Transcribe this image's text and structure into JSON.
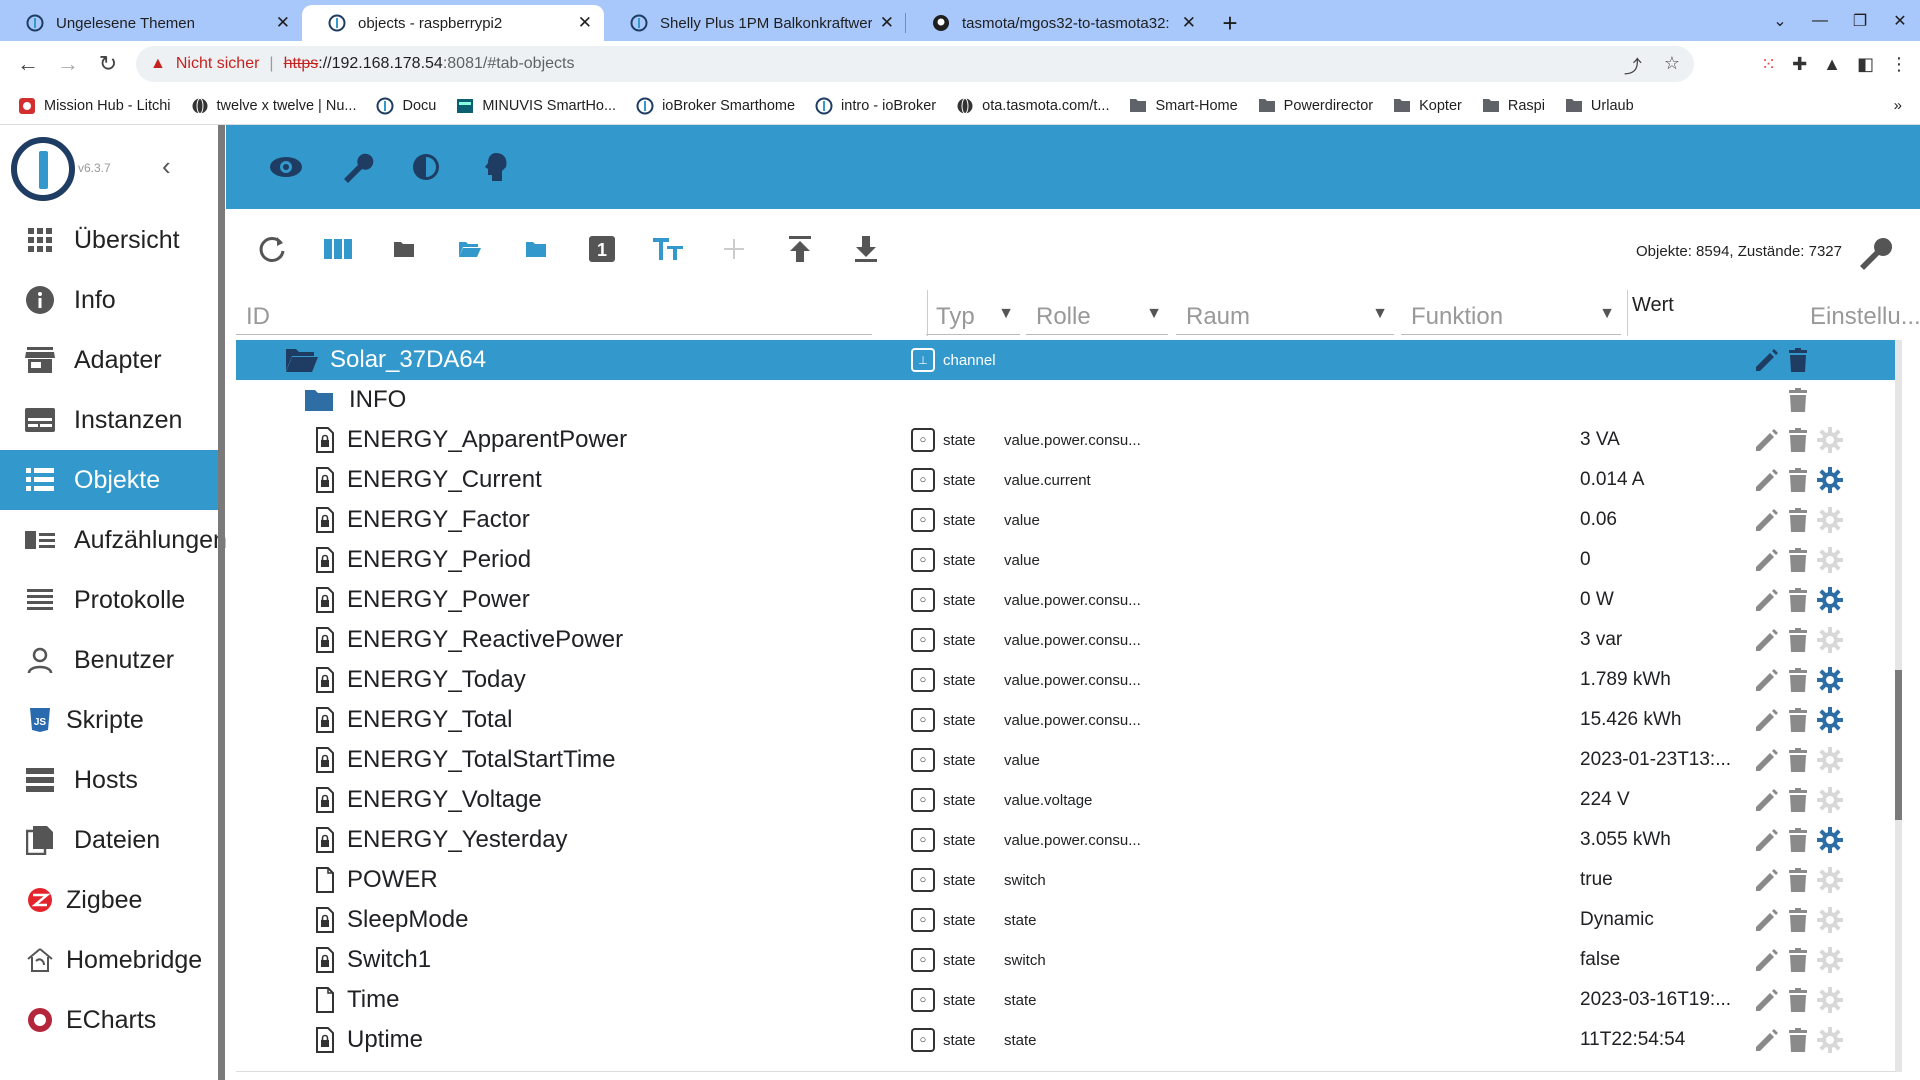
{
  "browser": {
    "tabs": [
      {
        "title": "Ungelesene Themen",
        "active": false
      },
      {
        "title": "objects - raspberrypi2",
        "active": true
      },
      {
        "title": "Shelly Plus 1PM Balkonkraftwerk",
        "active": false
      },
      {
        "title": "tasmota/mgos32-to-tasmota32: ",
        "active": false
      }
    ],
    "address": {
      "security_label": "Nicht sicher",
      "scheme": "https",
      "host": "://192.168.178.54",
      "path": ":8081/#tab-objects"
    },
    "bookmarks": [
      {
        "label": "Mission Hub - Litchi",
        "icon": "drone-icon"
      },
      {
        "label": "twelve x twelve | Nu...",
        "icon": "globe-icon"
      },
      {
        "label": "Docu",
        "icon": "iobroker-icon"
      },
      {
        "label": "MINUVIS SmartHo...",
        "icon": "minuvis-icon"
      },
      {
        "label": "ioBroker Smarthome",
        "icon": "iobroker-icon"
      },
      {
        "label": "intro - ioBroker",
        "icon": "iobroker-icon"
      },
      {
        "label": "ota.tasmota.com/t...",
        "icon": "globe-icon"
      },
      {
        "label": "Smart-Home",
        "icon": "folder-icon"
      },
      {
        "label": "Powerdirector",
        "icon": "folder-icon"
      },
      {
        "label": "Kopter",
        "icon": "folder-icon"
      },
      {
        "label": "Raspi",
        "icon": "folder-icon"
      },
      {
        "label": "Urlaub",
        "icon": "folder-icon"
      }
    ],
    "bookmarks_more": "»"
  },
  "app": {
    "version": "v6.3.7",
    "menu": [
      {
        "label": "Übersicht",
        "icon": "grid-icon",
        "active": false
      },
      {
        "label": "Info",
        "icon": "info-icon",
        "active": false
      },
      {
        "label": "Adapter",
        "icon": "store-icon",
        "active": false
      },
      {
        "label": "Instanzen",
        "icon": "instances-icon",
        "active": false
      },
      {
        "label": "Objekte",
        "icon": "list-icon",
        "active": true
      },
      {
        "label": "Aufzählungen",
        "icon": "enum-icon",
        "active": false
      },
      {
        "label": "Protokolle",
        "icon": "log-icon",
        "active": false
      },
      {
        "label": "Benutzer",
        "icon": "user-icon",
        "active": false
      },
      {
        "label": "Skripte",
        "icon": "js-icon",
        "active": false
      },
      {
        "label": "Hosts",
        "icon": "hosts-icon",
        "active": false
      },
      {
        "label": "Dateien",
        "icon": "files-icon",
        "active": false
      },
      {
        "label": "Zigbee",
        "icon": "zigbee-icon",
        "active": false
      },
      {
        "label": "Homebridge",
        "icon": "homebridge-icon",
        "active": false
      },
      {
        "label": "ECharts",
        "icon": "echarts-icon",
        "active": false
      }
    ],
    "counts": "Objekte: 8594, Zustände: 7327",
    "filters": {
      "id": "ID",
      "typ": "Typ",
      "rolle": "Rolle",
      "raum": "Raum",
      "funktion": "Funktion",
      "wert": "Wert",
      "einstellungen": "Einstellu..."
    },
    "rows": [
      {
        "name": "Solar_37DA64",
        "kind": "folder-open",
        "indent": 0,
        "type": "channel",
        "role": "",
        "value": "",
        "selected": true,
        "actions": "edit-delete"
      },
      {
        "name": "INFO",
        "kind": "folder",
        "indent": 1,
        "type": "",
        "role": "",
        "value": "",
        "selected": false,
        "actions": "delete"
      },
      {
        "name": "ENERGY_ApparentPower",
        "kind": "state-locked",
        "indent": 1,
        "type": "state",
        "role": "value.power.consu...",
        "value": "3 VA",
        "selected": false,
        "actions": "all",
        "custom": false
      },
      {
        "name": "ENERGY_Current",
        "kind": "state-locked",
        "indent": 1,
        "type": "state",
        "role": "value.current",
        "value": "0.014 A",
        "selected": false,
        "actions": "all",
        "custom": true
      },
      {
        "name": "ENERGY_Factor",
        "kind": "state-locked",
        "indent": 1,
        "type": "state",
        "role": "value",
        "value": "0.06",
        "selected": false,
        "actions": "all",
        "custom": false
      },
      {
        "name": "ENERGY_Period",
        "kind": "state-locked",
        "indent": 1,
        "type": "state",
        "role": "value",
        "value": "0",
        "selected": false,
        "actions": "all",
        "custom": false
      },
      {
        "name": "ENERGY_Power",
        "kind": "state-locked",
        "indent": 1,
        "type": "state",
        "role": "value.power.consu...",
        "value": "0 W",
        "selected": false,
        "actions": "all",
        "custom": true
      },
      {
        "name": "ENERGY_ReactivePower",
        "kind": "state-locked",
        "indent": 1,
        "type": "state",
        "role": "value.power.consu...",
        "value": "3 var",
        "selected": false,
        "actions": "all",
        "custom": false
      },
      {
        "name": "ENERGY_Today",
        "kind": "state-locked",
        "indent": 1,
        "type": "state",
        "role": "value.power.consu...",
        "value": "1.789 kWh",
        "selected": false,
        "actions": "all",
        "custom": true
      },
      {
        "name": "ENERGY_Total",
        "kind": "state-locked",
        "indent": 1,
        "type": "state",
        "role": "value.power.consu...",
        "value": "15.426 kWh",
        "selected": false,
        "actions": "all",
        "custom": true
      },
      {
        "name": "ENERGY_TotalStartTime",
        "kind": "state-locked",
        "indent": 1,
        "type": "state",
        "role": "value",
        "value": "2023-01-23T13:...",
        "selected": false,
        "actions": "all",
        "custom": false
      },
      {
        "name": "ENERGY_Voltage",
        "kind": "state-locked",
        "indent": 1,
        "type": "state",
        "role": "value.voltage",
        "value": "224 V",
        "selected": false,
        "actions": "all",
        "custom": false
      },
      {
        "name": "ENERGY_Yesterday",
        "kind": "state-locked",
        "indent": 1,
        "type": "state",
        "role": "value.power.consu...",
        "value": "3.055 kWh",
        "selected": false,
        "actions": "all",
        "custom": true
      },
      {
        "name": "POWER",
        "kind": "state",
        "indent": 1,
        "type": "state",
        "role": "switch",
        "value": "true",
        "selected": false,
        "actions": "all",
        "custom": false
      },
      {
        "name": "SleepMode",
        "kind": "state-locked",
        "indent": 1,
        "type": "state",
        "role": "state",
        "value": "Dynamic",
        "selected": false,
        "actions": "all",
        "custom": false
      },
      {
        "name": "Switch1",
        "kind": "state-locked",
        "indent": 1,
        "type": "state",
        "role": "switch",
        "value": "false",
        "selected": false,
        "actions": "all",
        "custom": false
      },
      {
        "name": "Time",
        "kind": "state",
        "indent": 1,
        "type": "state",
        "role": "state",
        "value": "2023-03-16T19:...",
        "selected": false,
        "actions": "all",
        "custom": false
      },
      {
        "name": "Uptime",
        "kind": "state-locked",
        "indent": 1,
        "type": "state",
        "role": "state",
        "value": "11T22:54:54",
        "selected": false,
        "actions": "all",
        "custom": false
      }
    ]
  },
  "colors": {
    "accent": "#3399cc",
    "gear_active": "#2f6ea5",
    "gear_inactive": "#d8d8d8",
    "action_grey": "#8a8a8a"
  }
}
